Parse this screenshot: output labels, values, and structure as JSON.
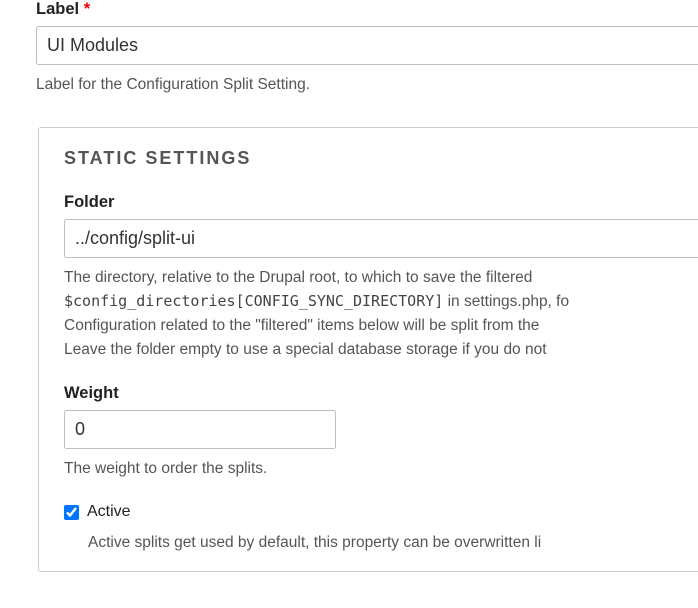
{
  "labelField": {
    "label": "Label",
    "required_mark": "*",
    "value": "UI Modules",
    "description": "Label for the Configuration Split Setting."
  },
  "staticSettings": {
    "legend": "STATIC SETTINGS",
    "folder": {
      "label": "Folder",
      "value": "../config/split-ui",
      "desc_line1_pre": "The directory, relative to the Drupal root, to which to save the filtered ",
      "desc_line2_code": "$config_directories[CONFIG_SYNC_DIRECTORY]",
      "desc_line2_post": " in settings.php, fo",
      "desc_line3": "Configuration related to the \"filtered\" items below will be split from the",
      "desc_line4": "Leave the folder empty to use a special database storage if you do not"
    },
    "weight": {
      "label": "Weight",
      "value": "0",
      "description": "The weight to order the splits."
    },
    "active": {
      "label": "Active",
      "checked": true,
      "description": "Active splits get used by default, this property can be overwritten li"
    }
  }
}
